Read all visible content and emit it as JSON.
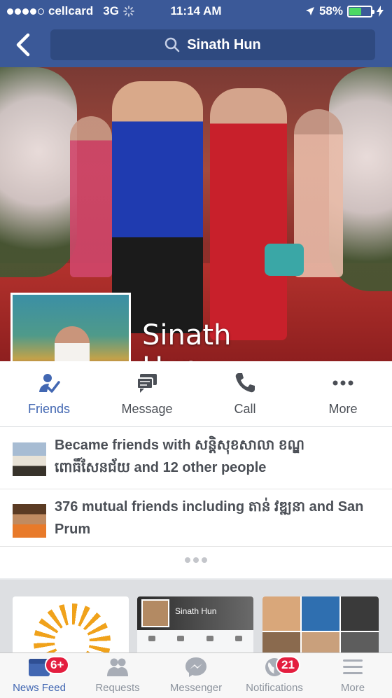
{
  "status_bar": {
    "carrier": "cellcard",
    "network": "3G",
    "time": "11:14 AM",
    "battery_percent": "58%",
    "battery_level": 0.58,
    "signal_bars_filled": 4,
    "signal_bars_total": 5
  },
  "nav": {
    "search_text": "Sinath Hun",
    "icons": {
      "back": "back-chevron-icon",
      "search": "search-icon"
    }
  },
  "profile": {
    "name_line1": "Sinath",
    "name_line2": "Hun"
  },
  "actions": [
    {
      "label": "Friends",
      "icon": "friends-check-icon",
      "active": true
    },
    {
      "label": "Message",
      "icon": "message-icon",
      "active": false
    },
    {
      "label": "Call",
      "icon": "phone-icon",
      "active": false
    },
    {
      "label": "More",
      "icon": "more-dots-icon",
      "active": false
    }
  ],
  "info": {
    "friends_line": "Became friends with សន្តិសុខសាលា ខណ្ឌពោធិ៍សែនជ័យ and 12 other people",
    "mutual_line": "376 mutual friends including តាន់ វឌ្ឍនា and San Prum"
  },
  "strip": {
    "mini_profile_name": "Sinath Hun"
  },
  "tabbar": {
    "items": [
      {
        "label": "News Feed",
        "icon": "news-feed-icon",
        "badge": "6+",
        "active": true
      },
      {
        "label": "Requests",
        "icon": "requests-icon",
        "badge": "",
        "active": false
      },
      {
        "label": "Messenger",
        "icon": "messenger-icon",
        "badge": "",
        "active": false
      },
      {
        "label": "Notifications",
        "icon": "globe-icon",
        "badge": "21",
        "active": false
      },
      {
        "label": "More",
        "icon": "menu-icon",
        "badge": "",
        "active": false
      }
    ]
  },
  "colors": {
    "brand_blue": "#3b5998",
    "active_blue": "#4267b2",
    "badge_red": "#e41e3f",
    "battery_green": "#4cd964"
  }
}
